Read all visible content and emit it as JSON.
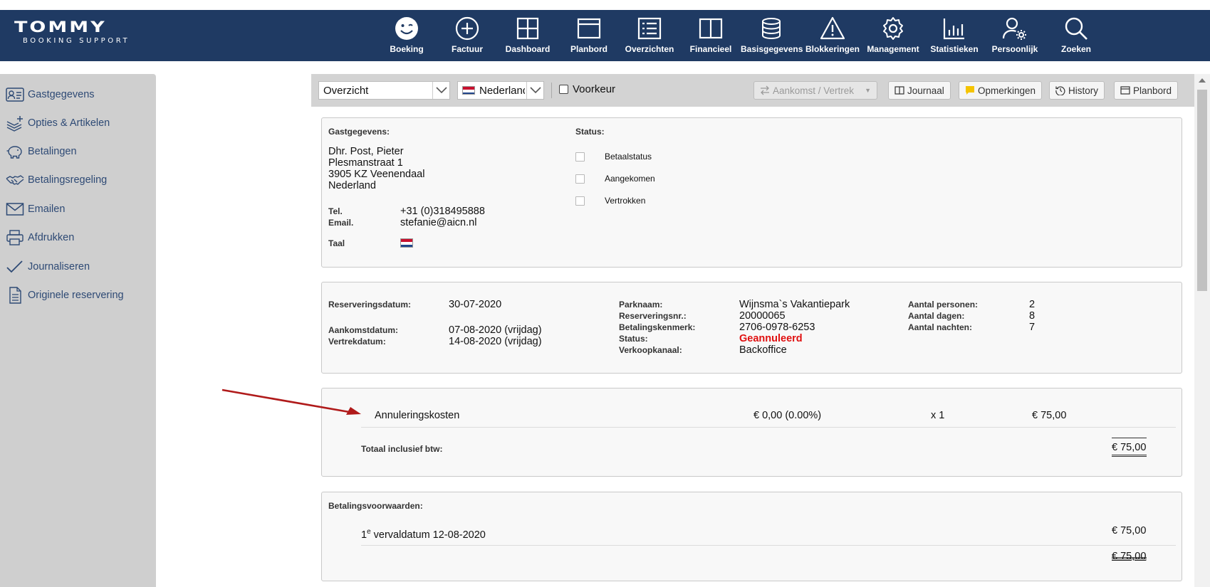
{
  "brand": {
    "name": "TOMMY",
    "tagline": "BOOKING SUPPORT"
  },
  "nav": [
    {
      "label": "Boeking",
      "icon": "smiley-icon"
    },
    {
      "label": "Factuur",
      "icon": "plus-circle-icon"
    },
    {
      "label": "Dashboard",
      "icon": "grid-icon"
    },
    {
      "label": "Planbord",
      "icon": "window-icon"
    },
    {
      "label": "Overzichten",
      "icon": "list-icon"
    },
    {
      "label": "Financieel",
      "icon": "book-icon"
    },
    {
      "label": "Basisgegevens",
      "icon": "database-icon"
    },
    {
      "label": "Blokkeringen",
      "icon": "warning-icon"
    },
    {
      "label": "Management",
      "icon": "gear-icon"
    },
    {
      "label": "Statistieken",
      "icon": "bar-chart-icon"
    },
    {
      "label": "Persoonlijk",
      "icon": "user-gear-icon"
    },
    {
      "label": "Zoeken",
      "icon": "search-icon"
    }
  ],
  "sidebar": {
    "items": [
      {
        "label": "Gastgegevens",
        "icon": "id-card-icon"
      },
      {
        "label": "Opties & Artikelen",
        "icon": "layers-plus-icon"
      },
      {
        "label": "Betalingen",
        "icon": "piggy-bank-icon"
      },
      {
        "label": "Betalingsregeling",
        "icon": "handshake-icon"
      },
      {
        "label": "Emailen",
        "icon": "envelope-icon"
      },
      {
        "label": "Afdrukken",
        "icon": "printer-icon"
      },
      {
        "label": "Journaliseren",
        "icon": "checkmark-icon"
      },
      {
        "label": "Originele reservering",
        "icon": "document-icon"
      }
    ]
  },
  "toolbar": {
    "view_select": "Overzicht",
    "language_select": "Nederland",
    "preference_label": "Voorkeur",
    "arrival_departure": "Aankomst / Vertrek",
    "journal": "Journaal",
    "remarks": "Opmerkingen",
    "history": "History",
    "planbord": "Planbord"
  },
  "guest": {
    "heading": "Gastgegevens:",
    "name": "Dhr. Post, Pieter",
    "street": "Plesmanstraat 1",
    "city": "3905 KZ Veenendaal",
    "country": "Nederland",
    "tel_label": "Tel.",
    "tel": "+31 (0)318495888",
    "email_label": "Email.",
    "email": "stefanie@aicn.nl",
    "language_label": "Taal"
  },
  "status": {
    "heading": "Status:",
    "items": [
      "Betaalstatus",
      "Aangekomen",
      "Vertrokken"
    ]
  },
  "reservation": {
    "date_label": "Reserveringsdatum:",
    "date": "30-07-2020",
    "arrival_label": "Aankomstdatum:",
    "arrival": "07-08-2020 (vrijdag)",
    "departure_label": "Vertrekdatum:",
    "departure": "14-08-2020 (vrijdag)",
    "park_label": "Parknaam:",
    "park": "Wijnsma`s Vakantiepark",
    "resnr_label": "Reserveringsnr.:",
    "resnr": "20000065",
    "paymark_label": "Betalingskenmerk:",
    "paymark": "2706-0978-6253",
    "status_label": "Status:",
    "status": "Geannuleerd",
    "channel_label": "Verkoopkanaal:",
    "channel": "Backoffice",
    "persons_label": "Aantal personen:",
    "persons": "2",
    "days_label": "Aantal dagen:",
    "days": "8",
    "nights_label": "Aantal nachten:",
    "nights": "7"
  },
  "costs": {
    "item": "Annuleringskosten",
    "price": "€ 0,00 (0.00%)",
    "qty": "x 1",
    "amount": "€ 75,00",
    "total_label": "Totaal inclusief btw:",
    "total": "€ 75,00"
  },
  "payment_terms": {
    "heading": "Betalingsvoorwaarden:",
    "ordinal": "1",
    "ordinal_suffix": "e",
    "due_text": " vervaldatum 12-08-2020",
    "due_amount": "€ 75,00",
    "total": "€ 75,00"
  },
  "colors": {
    "navbar": "#1f3a63",
    "sidebar": "#cfcfcf",
    "sidebar_text": "#2e4a75",
    "cancelled": "#e01010",
    "arrow": "#b01a1a"
  }
}
